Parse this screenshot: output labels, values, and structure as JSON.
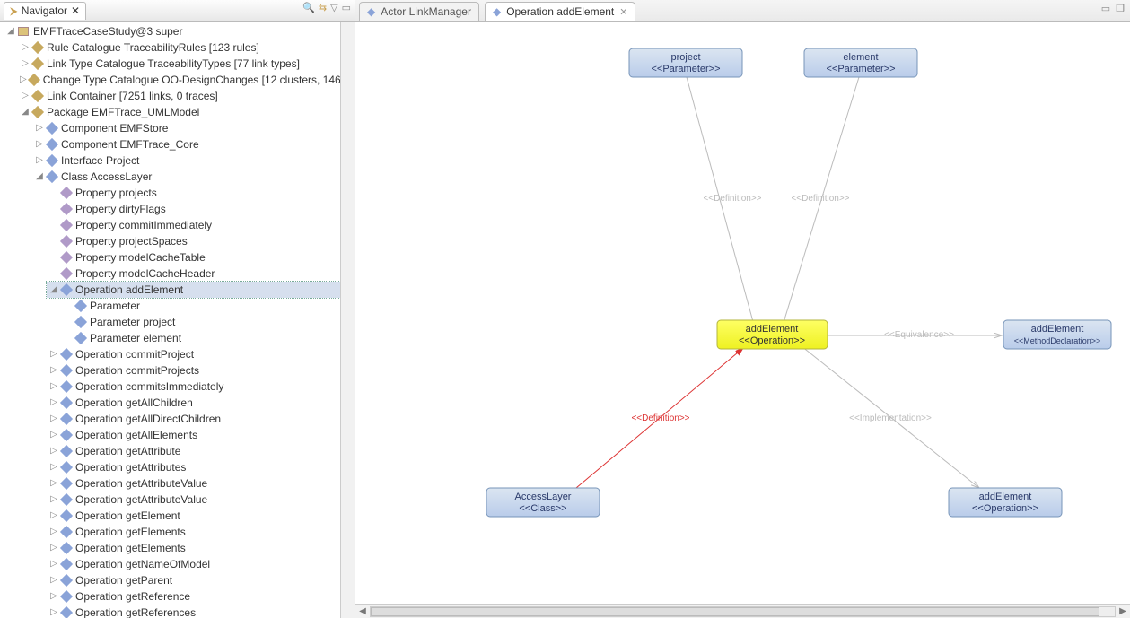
{
  "navigator": {
    "title": "Navigator",
    "root": "EMFTraceCaseStudy@3 super",
    "top_children": [
      "Rule Catalogue TraceabilityRules [123 rules]",
      "Link Type Catalogue TraceabilityTypes [77 link types]",
      "Change Type Catalogue OO-DesignChanges [12 clusters, 146",
      "Link Container [7251 links, 0 traces]"
    ],
    "package": "Package EMFTrace_UMLModel",
    "pkg_children": [
      "Component EMFStore",
      "Component EMFTrace_Core",
      "Interface Project"
    ],
    "class_node": "Class AccessLayer",
    "properties": [
      "Property projects",
      "Property dirtyFlags",
      "Property commitImmediately",
      "Property projectSpaces",
      "Property modelCacheTable",
      "Property modelCacheHeader"
    ],
    "selected_op": "Operation addElement",
    "params": [
      "Parameter",
      "Parameter project",
      "Parameter element"
    ],
    "operations": [
      "Operation commitProject",
      "Operation commitProjects",
      "Operation commitsImmediately",
      "Operation getAllChildren",
      "Operation getAllDirectChildren",
      "Operation getAllElements",
      "Operation getAttribute",
      "Operation getAttributes",
      "Operation getAttributeValue",
      "Operation getAttributeValue",
      "Operation getElement",
      "Operation getElements",
      "Operation getElements",
      "Operation getNameOfModel",
      "Operation getParent",
      "Operation getReference",
      "Operation getReferences"
    ]
  },
  "editor": {
    "tabs": [
      {
        "icon": "◆",
        "label": "Actor LinkManager"
      },
      {
        "icon": "◆",
        "label": "Operation addElement"
      }
    ]
  },
  "diagram": {
    "nodes": {
      "project": {
        "line1": "project",
        "line2": "<<Parameter>>"
      },
      "element": {
        "line1": "element",
        "line2": "<<Parameter>>"
      },
      "addElementOp": {
        "line1": "addElement",
        "line2": "<<Operation>>"
      },
      "addElementMD": {
        "line1": "addElement",
        "line2": "<<MethodDeclaration>>"
      },
      "accessLayer": {
        "line1": "AccessLayer",
        "line2": "<<Class>>"
      },
      "addElementOp2": {
        "line1": "addElement",
        "line2": "<<Operation>>"
      }
    },
    "edge_labels": {
      "def1": "<<Definition>>",
      "def2": "<<Definition>>",
      "equiv": "<<Equivalence>>",
      "defRed": "<<Definition>>",
      "impl": "<<Implementation>>"
    }
  }
}
